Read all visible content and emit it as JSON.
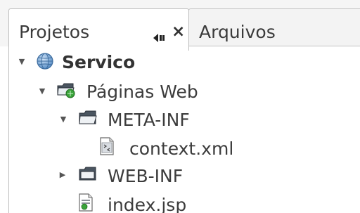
{
  "tabs": [
    {
      "label": "Projetos",
      "active": true
    },
    {
      "label": "Arquivos",
      "active": false
    }
  ],
  "tab_actions": {
    "minimize_icon": "minimize-icon",
    "close_glyph": "×"
  },
  "tree": {
    "project": {
      "label": "Servico",
      "expanded": true,
      "icon": "globe-icon"
    },
    "web_pages": {
      "label": "Páginas Web",
      "expanded": true,
      "icon": "web-folder-icon"
    },
    "meta_inf": {
      "label": "META-INF",
      "expanded": true,
      "icon": "folder-open-icon"
    },
    "context_xml": {
      "label": "context.xml",
      "icon": "xml-file-icon"
    },
    "web_inf": {
      "label": "WEB-INF",
      "expanded": false,
      "icon": "folder-icon"
    },
    "index_jsp": {
      "label": "index.jsp",
      "icon": "jsp-file-icon"
    }
  },
  "colors": {
    "tab_border": "#bdbdbd",
    "text": "#3c3c3c",
    "background": "#ffffff"
  }
}
